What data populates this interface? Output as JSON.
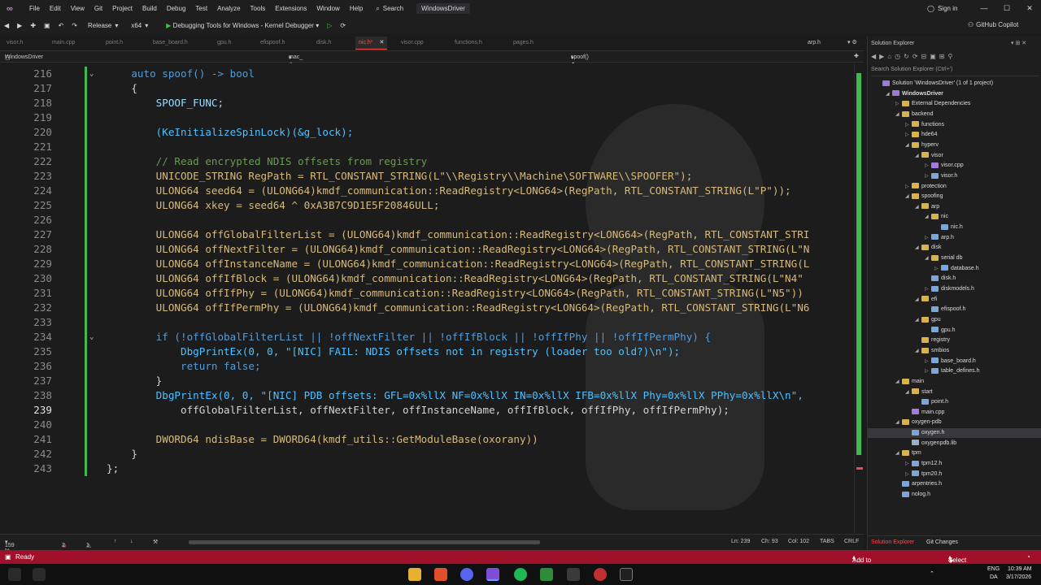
{
  "menubar": {
    "items": [
      "File",
      "Edit",
      "View",
      "Git",
      "Project",
      "Build",
      "Debug",
      "Test",
      "Analyze",
      "Tools",
      "Extensions",
      "Window",
      "Help"
    ],
    "search_label": "Search",
    "window_title": "WindowsDriver",
    "sign_in": "Sign in"
  },
  "toolbar": {
    "configuration": "Release",
    "platform": "x64",
    "debugger": "Debugging Tools for Windows - Kernel Debugger",
    "copilot": "GitHub Copilot"
  },
  "doc_tabs": {
    "tabs": [
      "visor.h",
      "main.cpp",
      "point.h",
      "base_board.h",
      "gpu.h",
      "efispoof.h",
      "disk.h",
      "nic.h*",
      "visor.cpp",
      "functions.h",
      "pages.h"
    ],
    "active_index": 7,
    "right_tab": "arp.h"
  },
  "navbar": {
    "project": "WindowsDriver",
    "scope": "mac_",
    "member": "spoof()"
  },
  "editor": {
    "current_line": 239,
    "lines": [
      {
        "n": "216",
        "t": "    auto spoof() -> bool"
      },
      {
        "n": "217",
        "t": "    {"
      },
      {
        "n": "218",
        "t": "        SPOOF_FUNC;"
      },
      {
        "n": "219",
        "t": ""
      },
      {
        "n": "220",
        "t": "        (KeInitializeSpinLock)(&g_lock);"
      },
      {
        "n": "221",
        "t": ""
      },
      {
        "n": "222",
        "t": "        // Read encrypted NDIS offsets from registry"
      },
      {
        "n": "223",
        "t": "        UNICODE_STRING RegPath = RTL_CONSTANT_STRING(L\"\\\\Registry\\\\Machine\\SOFTWARE\\\\SPOOFER\");"
      },
      {
        "n": "224",
        "t": "        ULONG64 seed64 = (ULONG64)kmdf_communication::ReadRegistry<LONG64>(RegPath, RTL_CONSTANT_STRING(L\"P\"));"
      },
      {
        "n": "225",
        "t": "        ULONG64 xkey = seed64 ^ 0xA3B7C9D1E5F20846ULL;"
      },
      {
        "n": "226",
        "t": ""
      },
      {
        "n": "227",
        "t": "        ULONG64 offGlobalFilterList = (ULONG64)kmdf_communication::ReadRegistry<LONG64>(RegPath, RTL_CONSTANT_STRI"
      },
      {
        "n": "228",
        "t": "        ULONG64 offNextFilter = (ULONG64)kmdf_communication::ReadRegistry<LONG64>(RegPath, RTL_CONSTANT_STRING(L\"N"
      },
      {
        "n": "229",
        "t": "        ULONG64 offInstanceName = (ULONG64)kmdf_communication::ReadRegistry<LONG64>(RegPath, RTL_CONSTANT_STRING(L"
      },
      {
        "n": "230",
        "t": "        ULONG64 offIfBlock = (ULONG64)kmdf_communication::ReadRegistry<LONG64>(RegPath, RTL_CONSTANT_STRING(L\"N4\""
      },
      {
        "n": "231",
        "t": "        ULONG64 offIfPhy = (ULONG64)kmdf_communication::ReadRegistry<LONG64>(RegPath, RTL_CONSTANT_STRING(L\"N5\"))"
      },
      {
        "n": "232",
        "t": "        ULONG64 offIfPermPhy = (ULONG64)kmdf_communication::ReadRegistry<LONG64>(RegPath, RTL_CONSTANT_STRING(L\"N6"
      },
      {
        "n": "233",
        "t": ""
      },
      {
        "n": "234",
        "t": "        if (!offGlobalFilterList || !offNextFilter || !offIfBlock || !offIfPhy || !offIfPermPhy) {"
      },
      {
        "n": "235",
        "t": "            DbgPrintEx(0, 0, \"[NIC] FAIL: NDIS offsets not in registry (loader too old?)\\n\");"
      },
      {
        "n": "236",
        "t": "            return false;"
      },
      {
        "n": "237",
        "t": "        }"
      },
      {
        "n": "238",
        "t": "        DbgPrintEx(0, 0, \"[NIC] PDB offsets: GFL=0x%llX NF=0x%llX IN=0x%llX IFB=0x%llX Phy=0x%llX PPhy=0x%llX\\n\","
      },
      {
        "n": "239",
        "t": "            offGlobalFilterList, offNextFilter, offInstanceName, offIfBlock, offIfPhy, offIfPermPhy);"
      },
      {
        "n": "240",
        "t": ""
      },
      {
        "n": "241",
        "t": "        DWORD64 ndisBase = DWORD64(kmdf_utils::GetModuleBase(oxorany))"
      },
      {
        "n": "242",
        "t": "    }"
      },
      {
        "n": "243",
        "t": "};"
      }
    ]
  },
  "status_row": {
    "zoom": "159 %",
    "errors": "2",
    "warnings": "1",
    "position": "Ln: 239",
    "char": "Ch: 93",
    "col": "Col: 102",
    "tabs": "TABS",
    "eol": "CRLF"
  },
  "solution_explorer": {
    "title": "Solution Explorer",
    "search_placeholder": "Search Solution Explorer (Ctrl+')",
    "nodes": [
      {
        "label": "Solution 'WindowsDriver' (1 of 1 project)",
        "depth": 0,
        "kind": "solution",
        "arrow": ""
      },
      {
        "label": "WindowsDriver",
        "depth": 1,
        "kind": "project",
        "arrow": "open"
      },
      {
        "label": "External Dependencies",
        "depth": 2,
        "kind": "folder",
        "arrow": "closed"
      },
      {
        "label": "backend",
        "depth": 2,
        "kind": "folder",
        "arrow": "open"
      },
      {
        "label": "functions",
        "depth": 3,
        "kind": "folder",
        "arrow": "closed"
      },
      {
        "label": "hde64",
        "depth": 3,
        "kind": "folder",
        "arrow": "closed"
      },
      {
        "label": "hyperv",
        "depth": 3,
        "kind": "folder",
        "arrow": "open"
      },
      {
        "label": "visor",
        "depth": 4,
        "kind": "folder",
        "arrow": "open"
      },
      {
        "label": "visor.cpp",
        "depth": 5,
        "kind": "cpp",
        "arrow": "closed"
      },
      {
        "label": "visor.h",
        "depth": 5,
        "kind": "h",
        "arrow": "closed"
      },
      {
        "label": "protection",
        "depth": 3,
        "kind": "folder",
        "arrow": "closed"
      },
      {
        "label": "spoofing",
        "depth": 3,
        "kind": "folder",
        "arrow": "open"
      },
      {
        "label": "arp",
        "depth": 4,
        "kind": "folder",
        "arrow": "open"
      },
      {
        "label": "nic",
        "depth": 5,
        "kind": "folder",
        "arrow": "open"
      },
      {
        "label": "nic.h",
        "depth": 6,
        "kind": "h",
        "arrow": ""
      },
      {
        "label": "arp.h",
        "depth": 5,
        "kind": "h",
        "arrow": "closed"
      },
      {
        "label": "disk",
        "depth": 4,
        "kind": "folder",
        "arrow": "open"
      },
      {
        "label": "serial db",
        "depth": 5,
        "kind": "folder",
        "arrow": "open"
      },
      {
        "label": "database.h",
        "depth": 6,
        "kind": "h",
        "arrow": "closed"
      },
      {
        "label": "disk.h",
        "depth": 5,
        "kind": "h",
        "arrow": ""
      },
      {
        "label": "diskmodels.h",
        "depth": 5,
        "kind": "h",
        "arrow": "closed"
      },
      {
        "label": "efi",
        "depth": 4,
        "kind": "folder",
        "arrow": "open"
      },
      {
        "label": "efispoof.h",
        "depth": 5,
        "kind": "h",
        "arrow": ""
      },
      {
        "label": "gpu",
        "depth": 4,
        "kind": "folder",
        "arrow": "open"
      },
      {
        "label": "gpu.h",
        "depth": 5,
        "kind": "h",
        "arrow": ""
      },
      {
        "label": "registry",
        "depth": 4,
        "kind": "folder",
        "arrow": ""
      },
      {
        "label": "smbios",
        "depth": 4,
        "kind": "folder",
        "arrow": "open"
      },
      {
        "label": "base_board.h",
        "depth": 5,
        "kind": "h",
        "arrow": "closed"
      },
      {
        "label": "table_defines.h",
        "depth": 5,
        "kind": "h",
        "arrow": "closed"
      },
      {
        "label": "main",
        "depth": 2,
        "kind": "folder",
        "arrow": "open"
      },
      {
        "label": "start",
        "depth": 3,
        "kind": "folder",
        "arrow": "open"
      },
      {
        "label": "point.h",
        "depth": 4,
        "kind": "h",
        "arrow": ""
      },
      {
        "label": "main.cpp",
        "depth": 3,
        "kind": "cpp",
        "arrow": ""
      },
      {
        "label": "oxygen-pdb",
        "depth": 2,
        "kind": "folder",
        "arrow": "open"
      },
      {
        "label": "oxygen.h",
        "depth": 3,
        "kind": "h",
        "arrow": "",
        "selected": true
      },
      {
        "label": "oxygenpdb.lib",
        "depth": 3,
        "kind": "lib",
        "arrow": ""
      },
      {
        "label": "tpm",
        "depth": 2,
        "kind": "folder",
        "arrow": "open"
      },
      {
        "label": "tpm12.h",
        "depth": 3,
        "kind": "h",
        "arrow": "closed"
      },
      {
        "label": "tpm20.h",
        "depth": 3,
        "kind": "h",
        "arrow": "closed"
      },
      {
        "label": "arpentries.h",
        "depth": 2,
        "kind": "h",
        "arrow": ""
      },
      {
        "label": "nolog.h",
        "depth": 2,
        "kind": "h",
        "arrow": ""
      }
    ],
    "bottom_tabs": [
      "Solution Explorer",
      "Git Changes"
    ]
  },
  "statusbar": {
    "ready": "Ready",
    "add_source_control": "Add to Source Control",
    "select_repository": "Select Repository"
  },
  "taskbar": {
    "language": "ENG",
    "region": "DA",
    "time": "10:39 AM",
    "date": "3/17/2026"
  },
  "colors": {
    "keyword": "#569cd6",
    "function": "#4fc1ff",
    "macro": "#9cdcfe",
    "type": "#d7ba7d",
    "string": "#d69d85",
    "comment": "#6a9955",
    "status_bar": "#a0102a",
    "change_green": "#3fb950"
  }
}
